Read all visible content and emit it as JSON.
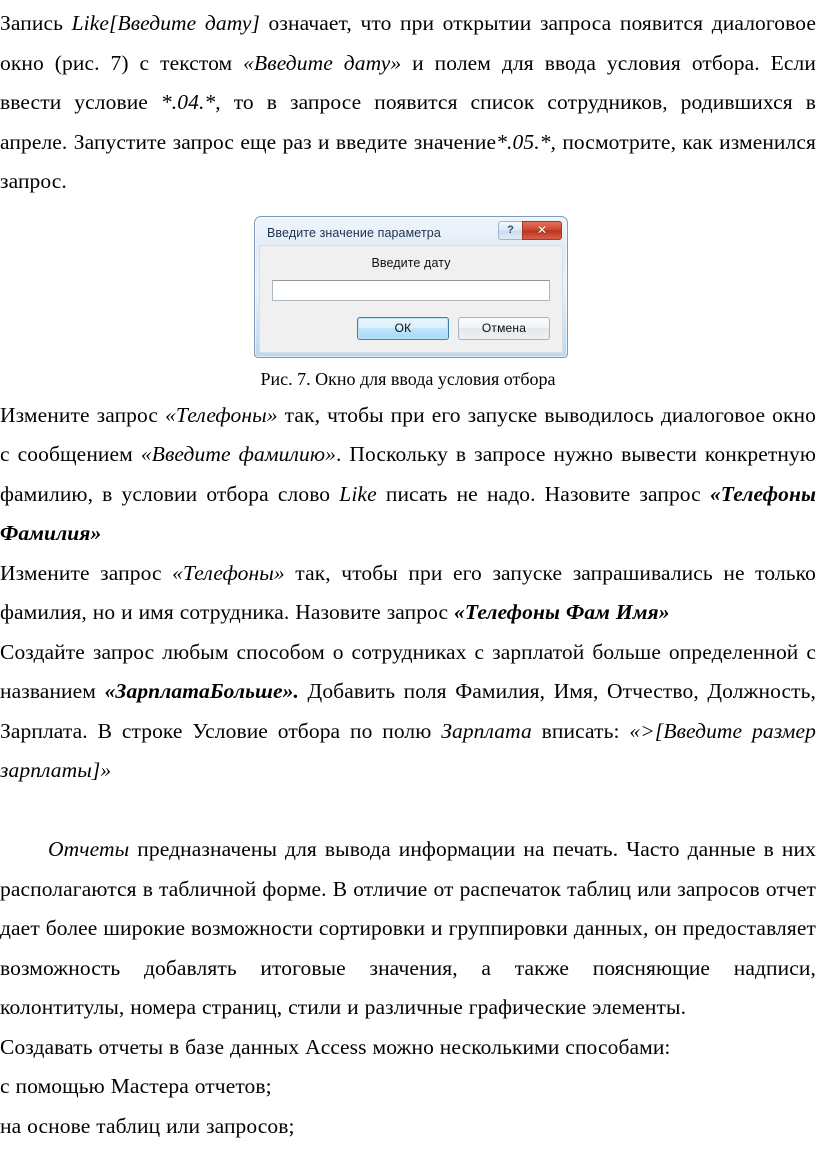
{
  "document": {
    "language": "ru",
    "paragraphs": [
      {
        "id": "p1",
        "runs": [
          {
            "text": "Запись ",
            "style": "normal"
          },
          {
            "text": "Like[Введите дату]",
            "style": "italic"
          },
          {
            "text": " означает, что при открытии запроса появится диалоговое окно (рис. 7) с текстом ",
            "style": "normal"
          },
          {
            "text": "«Введите дату»",
            "style": "italic"
          },
          {
            "text": " и полем для ввода условия отбора. Если ввести условие ",
            "style": "normal"
          },
          {
            "text": "*.04.*,",
            "style": "italic"
          },
          {
            "text": " то в запросе появится список сотрудников, родившихся в апреле. Запустите запрос еще раз и введите значение",
            "style": "normal"
          },
          {
            "text": "*.05.*,",
            "style": "italic"
          },
          {
            "text": " посмотрите, как изменился запрос.",
            "style": "normal"
          }
        ]
      },
      {
        "id": "p2",
        "runs": [
          {
            "text": "Измените запрос ",
            "style": "normal"
          },
          {
            "text": "«Телефоны»",
            "style": "italic"
          },
          {
            "text": " так, чтобы при его запуске выводилось диалоговое окно с сообщением ",
            "style": "normal"
          },
          {
            "text": "«Введите фамилию»",
            "style": "italic"
          },
          {
            "text": ". Поскольку в запросе нужно вывести конкретную фамилию, в условии отбора слово ",
            "style": "normal"
          },
          {
            "text": "Like",
            "style": "italic"
          },
          {
            "text": " писать не надо. Назовите запрос ",
            "style": "normal"
          },
          {
            "text": "«Телефоны Фамилия»",
            "style": "bold-italic"
          }
        ]
      },
      {
        "id": "p3",
        "runs": [
          {
            "text": "Измените запрос ",
            "style": "normal"
          },
          {
            "text": "«Телефоны»",
            "style": "italic"
          },
          {
            "text": " так, чтобы при его запуске запрашивались не только фамилия, но и имя сотрудника. Назовите запрос ",
            "style": "normal"
          },
          {
            "text": "«Телефоны Фам Имя»",
            "style": "bold-italic"
          }
        ]
      },
      {
        "id": "p4",
        "runs": [
          {
            "text": "Создайте запрос любым способом о сотрудниках с зарплатой больше определенной с названием ",
            "style": "normal"
          },
          {
            "text": "«ЗарплатаБольше».",
            "style": "bold-italic"
          },
          {
            "text": " Добавить поля Фамилия, Имя, Отчество, Должность, Зарплата. В строке Условие отбора по полю ",
            "style": "normal"
          },
          {
            "text": "Зарплата",
            "style": "italic"
          },
          {
            "text": " вписать: ",
            "style": "normal"
          },
          {
            "text": "«>[Введите размер зарплаты]»",
            "style": "italic"
          }
        ]
      },
      {
        "id": "p5",
        "indent": true,
        "runs": [
          {
            "text": "Отчеты",
            "style": "italic"
          },
          {
            "text": " предназначены для вывода информации на печать. Часто данные в них располагаются в табличной форме. В отличие от распечаток таблиц или запросов отчет дает более широкие возможности сортировки и группировки данных, он предоставляет возможность добавлять итоговые значения, а также поясняющие надписи, колонтитулы, номера страниц, стили и различные графические элементы.",
            "style": "normal"
          }
        ]
      },
      {
        "id": "p6",
        "runs": [
          {
            "text": "Создавать отчеты в базе данных Access можно несколькими способами:",
            "style": "normal"
          }
        ]
      },
      {
        "id": "p7",
        "runs": [
          {
            "text": "с помощью Мастера отчетов;",
            "style": "normal"
          }
        ]
      },
      {
        "id": "p8",
        "runs": [
          {
            "text": "на основе таблиц или запросов;",
            "style": "normal"
          }
        ]
      }
    ]
  },
  "figure": {
    "caption": "Рис. 7. Окно для ввода условия отбора",
    "dialog": {
      "title": "Введите значение параметра",
      "help_button_label": "?",
      "close_button_label": "✕",
      "prompt": "Введите дату",
      "input_value": "",
      "input_placeholder": "",
      "ok_label": "ОК",
      "cancel_label": "Отмена",
      "colors": {
        "title_text": "#20364f",
        "close_button": "#cf4a33",
        "default_button_border": "#3c7fb1",
        "client_background": "#f0f0f0"
      }
    }
  }
}
